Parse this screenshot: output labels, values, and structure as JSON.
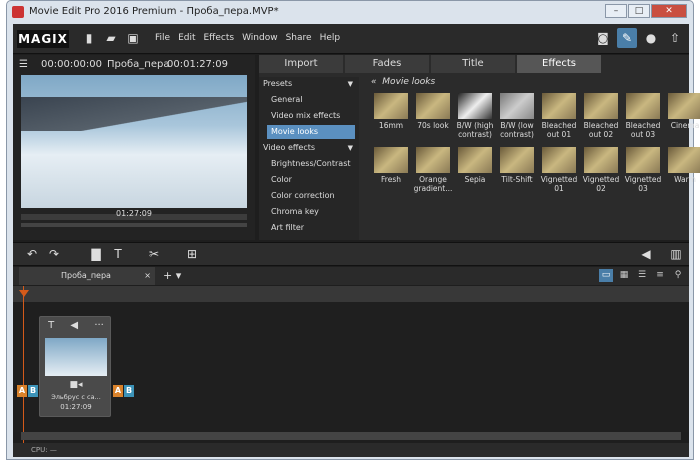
{
  "window": {
    "title": "Movie Edit Pro 2016 Premium - Проба_пера.MVP*"
  },
  "app": {
    "logo": "MAGIX"
  },
  "menu": [
    "File",
    "Edit",
    "Effects",
    "Window",
    "Share",
    "Help"
  ],
  "preview": {
    "timecode_left": "00:00:00:00",
    "project_name": "Проба_пера",
    "timecode_right": "00:01:27:09",
    "scrub_time": "01:27:09",
    "transport": [
      "[",
      "]",
      "[⇤",
      "▶",
      "[▸]",
      "⇥"
    ]
  },
  "tabs": [
    "Import",
    "Fades",
    "Title",
    "Effects"
  ],
  "active_tab": "Effects",
  "categories": {
    "presets": "Presets",
    "preset_items": [
      "General",
      "Video mix effects",
      "Movie looks"
    ],
    "selected": "Movie looks",
    "video_effects": "Video effects",
    "video_items": [
      "Brightness/Contrast",
      "Color",
      "Color correction",
      "Chroma key",
      "Art filter"
    ]
  },
  "effects": {
    "heading": "Movie looks",
    "row1": [
      "16mm",
      "70s look",
      "B/W (high contrast)",
      "B/W (low contrast)",
      "Bleached out 01",
      "Bleached out 02",
      "Bleached out 03",
      "Cinema"
    ],
    "row2": [
      "Fresh",
      "Orange gradient...",
      "Sepia",
      "Tilt-Shift",
      "Vignetted 01",
      "Vignetted 02",
      "Vignetted 03",
      "Warm"
    ]
  },
  "project_tab": {
    "name": "Проба_пера",
    "close": "×",
    "add": "+ ▾"
  },
  "clip": {
    "name": "Эльбрус с са...",
    "duration": "01:27:09"
  },
  "status": {
    "cpu": "CPU: —"
  }
}
